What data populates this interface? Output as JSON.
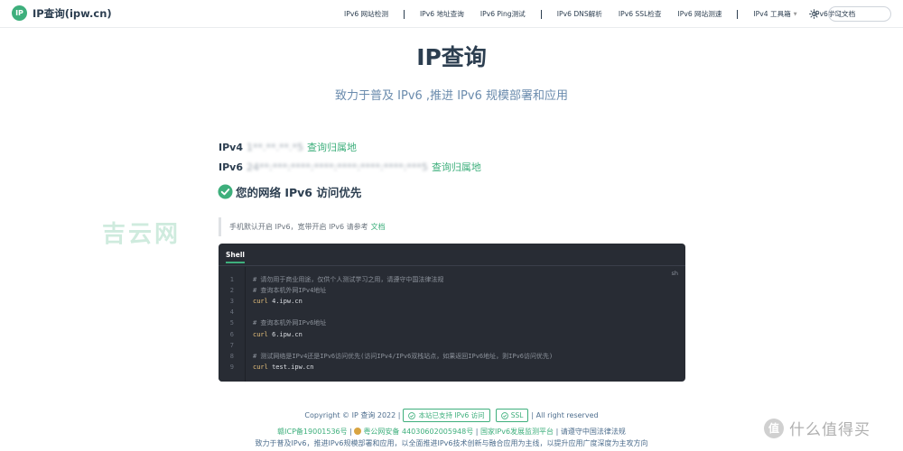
{
  "nav": {
    "logo_mark": "IP",
    "logo_text": "IP查询(ipw.cn)",
    "links": [
      "IPv6 网站检测",
      "IPv6 地址查询",
      "IPv6 Ping测试",
      "IPv6 DNS解析",
      "IPv6 SSL检查",
      "IPv6 网站测速",
      "IPv4 工具箱",
      "IPv6学习文档"
    ],
    "search_placeholder": ""
  },
  "hero": {
    "title": "IP查询",
    "subtitle": "致力于普及 IPv6 ,推进 IPv6 规模部署和应用"
  },
  "ip": {
    "v4_label": "IPv4",
    "v4_addr": "1**.**.**.*5",
    "v4_link": "查询归属地",
    "v6_label": "IPv6",
    "v6_addr": "24**:***:****:****:****:****:****:***5",
    "v6_link": "查询归属地"
  },
  "status": {
    "text": "您的网络 IPv6 访问优先",
    "color": "#3eaf7c"
  },
  "watermark": "吉云网",
  "tip": {
    "text": "手机默认开启 IPv6，宽带开启 IPv6 请参考",
    "link": "文档"
  },
  "code": {
    "tab": "Shell",
    "lang": "sh",
    "lines": [
      {
        "n": "1",
        "type": "comment",
        "text": "# 请勿用于商业用途，仅供个人测试学习之用，请遵守中国法律法规"
      },
      {
        "n": "2",
        "type": "comment",
        "text": "# 查询本机外网IPv4地址"
      },
      {
        "n": "3",
        "type": "cmd",
        "cmd": "curl",
        "arg": "4.ipw.cn"
      },
      {
        "n": "4",
        "type": "blank",
        "text": ""
      },
      {
        "n": "5",
        "type": "comment",
        "text": "# 查询本机外网IPv6地址"
      },
      {
        "n": "6",
        "type": "cmd",
        "cmd": "curl",
        "arg": "6.ipw.cn"
      },
      {
        "n": "7",
        "type": "blank",
        "text": ""
      },
      {
        "n": "8",
        "type": "comment",
        "text": "# 测试网络是IPv4还是IPv6访问优先(访问IPv4/IPv6双栈站点，如果返回IPv6地址，则IPv6访问优先)"
      },
      {
        "n": "9",
        "type": "cmd",
        "cmd": "curl",
        "arg": "test.ipw.cn"
      }
    ]
  },
  "footer": {
    "copyright": "Copyright © IP 查询 2022 |",
    "badge_ipv6": "本站已支持 IPv6 访问",
    "badge_ssl": "SSL",
    "rights": "| All right reserved",
    "icp": "赣ICP备19001536号",
    "sep1": " | ",
    "police": "粤公网安备 44030602005948号",
    "sep2": " | ",
    "platform": "国家IPv6发展监测平台",
    "sep3": " | ",
    "law": "请遵守中国法律法规",
    "mission": "致力于普及IPv6，推进IPv6规模部署和应用，以全面推进IPv6技术创新与融合应用为主线，以提升应用广度深度为主攻方向"
  },
  "corner": {
    "mark": "值",
    "text": "什么值得买"
  },
  "colors": {
    "accent": "#3eaf7c",
    "code_bg": "#282c34"
  }
}
